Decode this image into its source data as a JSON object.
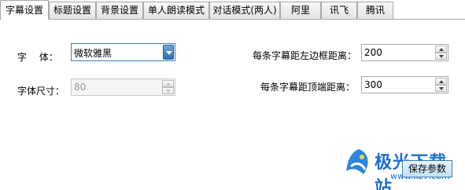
{
  "tabs": [
    {
      "label": "字幕设置",
      "active": true
    },
    {
      "label": "标题设置",
      "active": false
    },
    {
      "label": "背景设置",
      "active": false
    },
    {
      "label": "单人朗读模式",
      "active": false
    },
    {
      "label": "对话模式(两人)",
      "active": false
    },
    {
      "label": "阿里",
      "active": false
    },
    {
      "label": "讯飞",
      "active": false
    },
    {
      "label": "腾讯",
      "active": false
    }
  ],
  "font": {
    "label": "字　 体：",
    "value": "微软雅黑"
  },
  "font_size": {
    "label": "字体尺寸：",
    "value": "80",
    "disabled": true
  },
  "left_margin": {
    "label": "每条字幕距左边框距离：",
    "value": "200"
  },
  "top_margin": {
    "label": "每条字幕距顶端距离：",
    "value": "300"
  },
  "save_button": {
    "label": "保存参数"
  },
  "watermark": {
    "text": "极光下载站",
    "url": "www.xz7.com"
  },
  "colors": {
    "accent": "#3c7fb1",
    "watermark": "#1a6fcf"
  }
}
